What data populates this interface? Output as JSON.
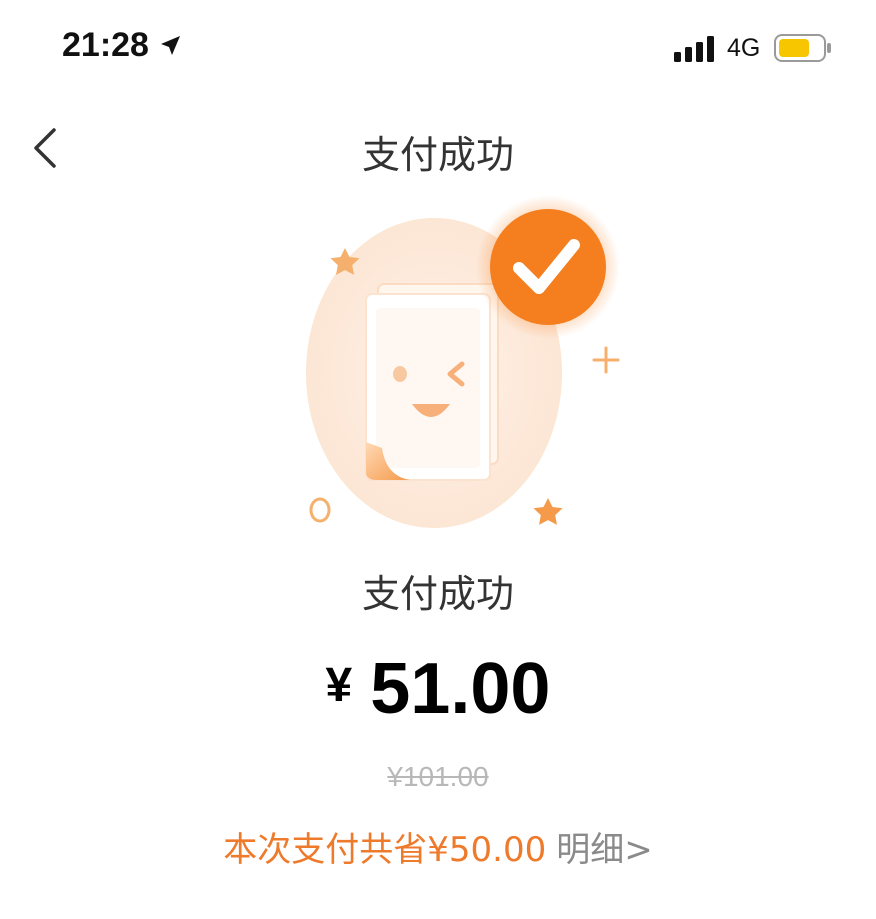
{
  "status_bar": {
    "time": "21:28",
    "network": "4G",
    "icons": [
      "location-arrow-icon",
      "signal-bars-icon",
      "battery-icon"
    ],
    "battery_color": "#F7C600"
  },
  "nav": {
    "back_icon": "chevron-left-icon",
    "title": "支付成功"
  },
  "illustration": {
    "description_icon": "receipt-wink-face-icon",
    "check_badge_icon": "check-icon",
    "accent_color": "#F57F1F",
    "background_color": "#FDEBDD"
  },
  "result": {
    "title": "支付成功",
    "currency": "¥",
    "amount": "51.00",
    "original_price": "¥101.00",
    "savings_text": "本次支付共省¥50.00",
    "details_link": "明细>"
  },
  "colors": {
    "savings": "#EE7A2C",
    "muted": "#8A8A8A",
    "strikethrough": "#B8B8B8"
  }
}
